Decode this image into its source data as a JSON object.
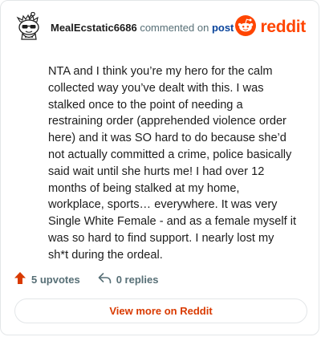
{
  "comment": {
    "username": "MealEcstatic6686",
    "action_text": "commented on",
    "post_link": "post",
    "body": "NTA and I think you’re my hero for the calm collected way you’ve dealt with this. I was stalked once to the point of needing a restraining order (apprehended violence order here) and it was SO hard to do because she’d not actually committed a crime, police basically said wait until she hurts me! I had over 12 months of being stalked at my home, workplace, sports… everywhere. It was very Single White Female - and as a female myself it was so hard to find support. I nearly lost my sh*t during the ordeal."
  },
  "brand": {
    "wordmark": "reddit",
    "accent": "#ff4500"
  },
  "actions": {
    "upvotes": "5 upvotes",
    "replies": "0 replies"
  },
  "footer": {
    "view_more": "View more on Reddit"
  },
  "icons": {
    "avatar": "snoo-avatar-icon",
    "logo": "reddit-logo-icon",
    "upvote": "upvote-arrow-icon",
    "reply": "reply-icon"
  }
}
